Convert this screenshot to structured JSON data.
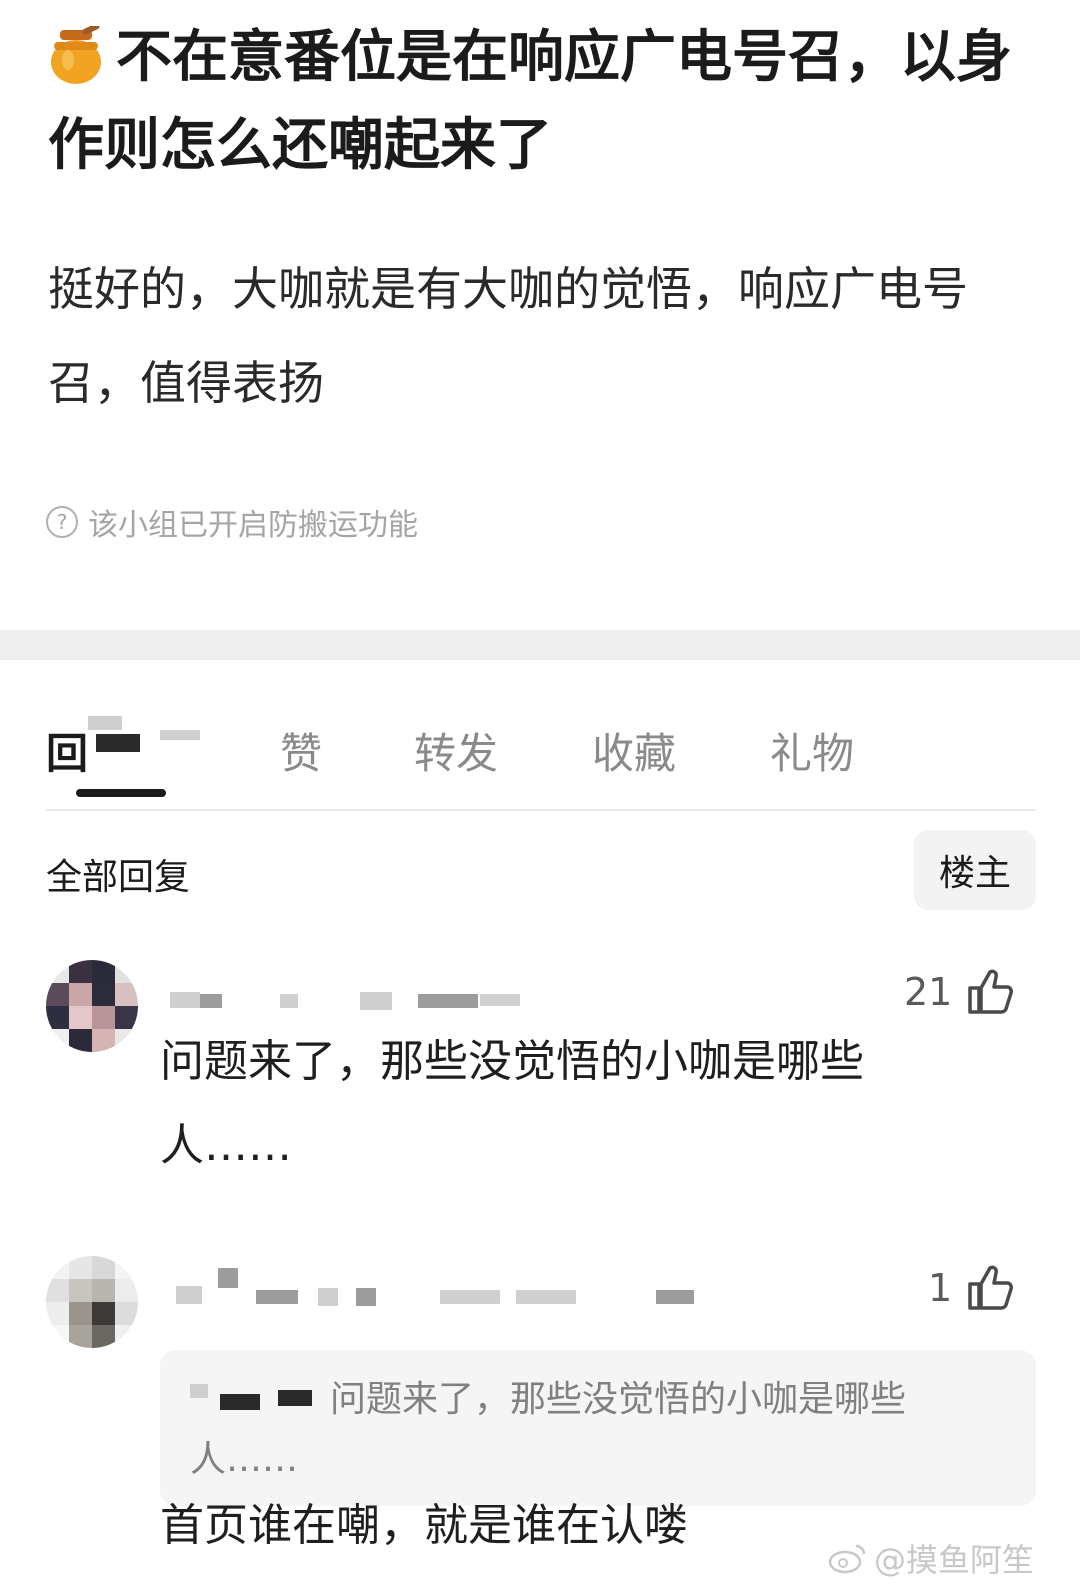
{
  "post": {
    "title": "不在意番位是在响应广电号召，以身作则怎么还嘲起来了",
    "title_icon": "honey-pot-icon",
    "body": "挺好的，大咖就是有大咖的觉悟，响应广电号召，值得表扬",
    "notice": "该小组已开启防搬运功能",
    "notice_icon": "help-circle-icon"
  },
  "tabs": [
    {
      "label": "回",
      "active": true
    },
    {
      "label": "赞",
      "active": false
    },
    {
      "label": "转发",
      "active": false
    },
    {
      "label": "收藏",
      "active": false
    },
    {
      "label": "礼物",
      "active": false
    }
  ],
  "replies_header": {
    "title": "全部回复",
    "filter_button": "楼主"
  },
  "comments": [
    {
      "likes": "21",
      "text": "问题来了，那些没觉悟的小咖是哪些人……"
    },
    {
      "likes": "1",
      "quote": "问题来了，那些没觉悟的小咖是哪些人……",
      "text": "首页谁在嘲，就是谁在认喽"
    }
  ],
  "watermark": "@摸鱼阿笙",
  "colors": {
    "text_primary": "#1b1b1b",
    "text_muted": "#a5a5a5",
    "band": "#efefef",
    "honey": "#f2a322"
  }
}
